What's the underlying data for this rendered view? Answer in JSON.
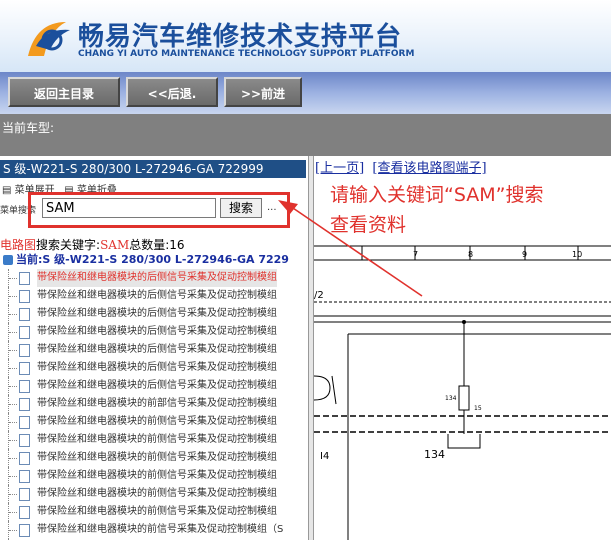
{
  "header": {
    "title": "畅易汽车维修技术支持平台",
    "subtitle": "CHANG YI AUTO MAINTENANCE TECHNOLOGY SUPPORT PLATFORM"
  },
  "nav": {
    "home": "返回主目录",
    "back": "<<后退.",
    "forward": ">>前进"
  },
  "status": {
    "current_model_label": "当前车型:"
  },
  "left": {
    "model": "S 级-W221-S 280/300 L-272946-GA 722999",
    "expand_all": "菜单展开",
    "collapse_all": "菜单折叠",
    "search_label": "菜单搜索",
    "search_value": "SAM",
    "search_button": "搜索",
    "ellipsis": "...",
    "result": {
      "prefix": "电路图",
      "keyword_label": "搜索关键字:",
      "keyword": "SAM",
      "count_label": "总数量:",
      "count": "16"
    },
    "root": "当前:S 级-W221-S 280/300 L-272946-GA 7229",
    "items": [
      "带保险丝和继电器模块的后侧信号采集及促动控制模组",
      "带保险丝和继电器模块的后侧信号采集及促动控制模组",
      "带保险丝和继电器模块的后侧信号采集及促动控制模组",
      "带保险丝和继电器模块的后侧信号采集及促动控制模组",
      "带保险丝和继电器模块的后侧信号采集及促动控制模组",
      "带保险丝和继电器模块的后侧信号采集及促动控制模组",
      "带保险丝和继电器模块的后侧信号采集及促动控制模组",
      "带保险丝和继电器模块的前部信号采集及促动控制模组",
      "带保险丝和继电器模块的前侧信号采集及促动控制模组",
      "带保险丝和继电器模块的前侧信号采集及促动控制模组",
      "带保险丝和继电器模块的前侧信号采集及促动控制模组",
      "带保险丝和继电器模块的前侧信号采集及促动控制模组",
      "带保险丝和继电器模块的前侧信号采集及促动控制模组",
      "带保险丝和继电器模块的前侧信号采集及促动控制模组",
      "带保险丝和继电器模块的前信号采集及促动控制模组（S",
      "带保险丝和继电器模块的前信号采集及促动控制模组（S"
    ]
  },
  "right": {
    "prev_page": "[上一页]",
    "view_terminal": "[查看该电路图端子]",
    "callout_line1": "请输入关键词“SAM”搜索",
    "callout_line2": "查看资料",
    "grid_numbers": [
      "7",
      "8",
      "9",
      "10"
    ],
    "diagram_labels": {
      "left_mark": "/2",
      "fuse_id": "134",
      "fuse_rating": "15",
      "connector": "I4",
      "wire_id": "134"
    }
  },
  "colors": {
    "brand_blue": "#1b4f9c",
    "highlight_red": "#e0322d",
    "nav_gray": "#808080"
  }
}
